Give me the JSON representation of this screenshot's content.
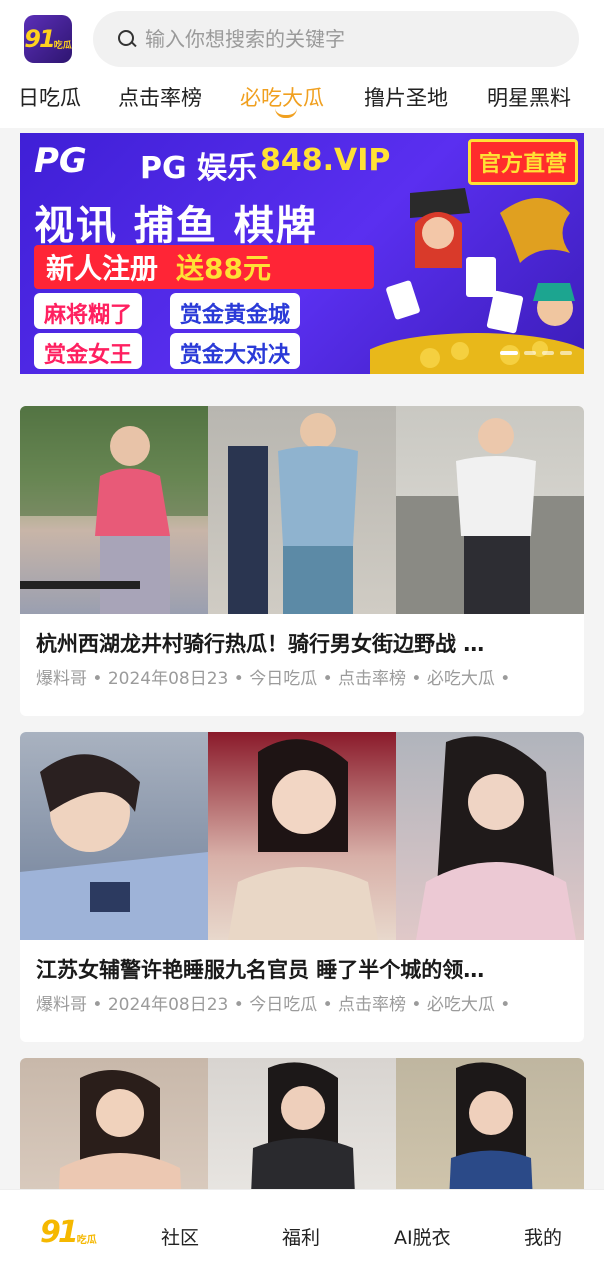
{
  "header": {
    "logo_text": "91",
    "logo_sub": "吃瓜",
    "search_placeholder": "输入你想搜索的关键字"
  },
  "tabs": [
    {
      "label": "日吃瓜",
      "active": false
    },
    {
      "label": "点击率榜",
      "active": false
    },
    {
      "label": "必吃大瓜",
      "active": true
    },
    {
      "label": "撸片圣地",
      "active": false
    },
    {
      "label": "明星黑料",
      "active": false
    }
  ],
  "banner": {
    "logo": "PG",
    "brand": "PG 娱乐",
    "domain": "848.VIP",
    "official": "官方直营",
    "categories": "视讯 捕鱼 棋牌",
    "new_user": "新人注册",
    "bonus": "送88元",
    "tags": [
      "麻将糊了",
      "赏金黄金城",
      "赏金女王",
      "赏金大对决"
    ],
    "slide_count": 4,
    "active_slide": 0
  },
  "posts": [
    {
      "title": "杭州西湖龙井村骑行热瓜！骑行男女街边野战 …",
      "meta": "爆料哥 • 2024年08日23 • 今日吃瓜 • 点击率榜 • 必吃大瓜 •"
    },
    {
      "title": "江苏女辅警许艳睡服九名官员 睡了半个城的领…",
      "meta": "爆料哥 • 2024年08日23 • 今日吃瓜 • 点击率榜 • 必吃大瓜 •"
    },
    {
      "title": "",
      "meta": ""
    }
  ],
  "bottom_nav": {
    "home_logo": "91",
    "home_logo_sub": "吃瓜",
    "items": [
      "社区",
      "福利",
      "AI脱衣",
      "我的"
    ]
  },
  "colors": {
    "accent": "#f0a020",
    "banner_bg": "#4a25e0",
    "banner_red": "#ff2536",
    "banner_yellow": "#ffe135"
  }
}
